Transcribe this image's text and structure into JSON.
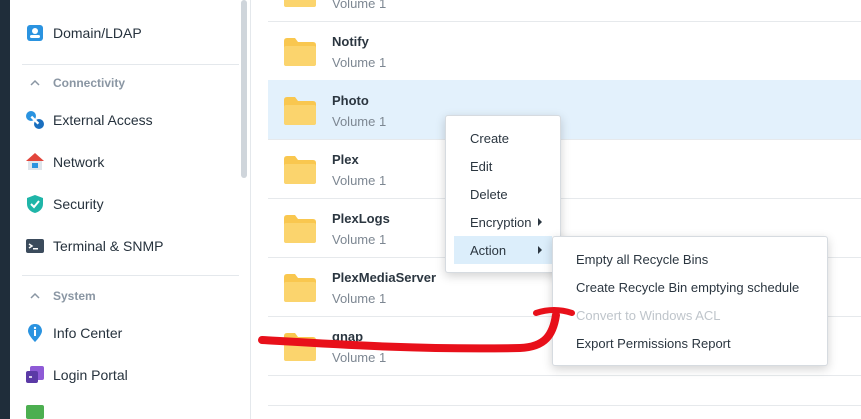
{
  "sidebar": {
    "items_top": [
      {
        "label": "Domain/LDAP",
        "icon": "user-card-icon"
      }
    ],
    "sections": [
      {
        "title": "Connectivity",
        "items": [
          {
            "label": "External Access",
            "icon": "external-access-icon"
          },
          {
            "label": "Network",
            "icon": "network-house-icon"
          },
          {
            "label": "Security",
            "icon": "shield-check-icon"
          },
          {
            "label": "Terminal & SNMP",
            "icon": "terminal-icon"
          }
        ]
      },
      {
        "title": "System",
        "items": [
          {
            "label": "Info Center",
            "icon": "info-pin-icon"
          },
          {
            "label": "Login Portal",
            "icon": "login-portal-icon"
          }
        ]
      }
    ]
  },
  "folders": [
    {
      "name": "",
      "volume": "Volume 1"
    },
    {
      "name": "Notify",
      "volume": "Volume 1"
    },
    {
      "name": "Photo",
      "volume": "Volume 1",
      "selected": true
    },
    {
      "name": "Plex",
      "volume": "Volume 1"
    },
    {
      "name": "PlexLogs",
      "volume": "Volume 1"
    },
    {
      "name": "PlexMediaServer",
      "volume": "Volume 1"
    },
    {
      "name": "qnap",
      "volume": "Volume 1"
    }
  ],
  "context_menu": {
    "items": [
      {
        "label": "Create"
      },
      {
        "label": "Edit"
      },
      {
        "label": "Delete"
      },
      {
        "label": "Encryption",
        "submenu": true
      },
      {
        "label": "Action",
        "submenu": true,
        "active": true
      }
    ]
  },
  "action_submenu": {
    "items": [
      {
        "label": "Empty all Recycle Bins",
        "enabled": true
      },
      {
        "label": "Create Recycle Bin emptying schedule",
        "enabled": true
      },
      {
        "label": "Convert to Windows ACL",
        "enabled": false
      },
      {
        "label": "Export Permissions Report",
        "enabled": true
      }
    ]
  },
  "colors": {
    "folder": "#f9c74f",
    "selected_row": "#e3f1fc",
    "annotation": "#e8101a"
  }
}
